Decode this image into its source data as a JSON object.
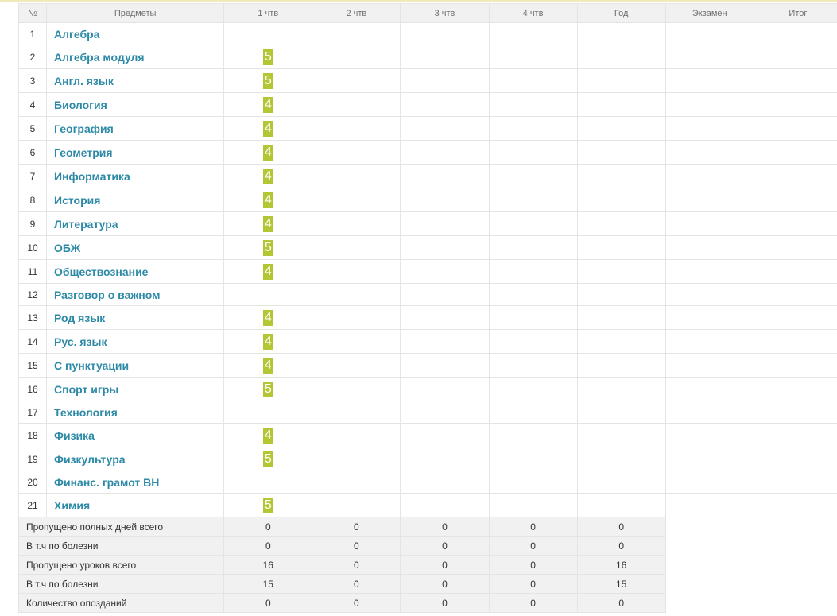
{
  "header": {
    "num": "№",
    "subjects": "Предметы",
    "q1": "1 чтв",
    "q2": "2 чтв",
    "q3": "3 чтв",
    "q4": "4 чтв",
    "year": "Год",
    "exam": "Экзамен",
    "final": "Итог"
  },
  "subjects": [
    {
      "num": "1",
      "name": "Алгебра",
      "q1": ""
    },
    {
      "num": "2",
      "name": "Алгебра модуля",
      "q1": "5"
    },
    {
      "num": "3",
      "name": "Англ. язык",
      "q1": "5"
    },
    {
      "num": "4",
      "name": "Биология",
      "q1": "4"
    },
    {
      "num": "5",
      "name": "География",
      "q1": "4"
    },
    {
      "num": "6",
      "name": "Геометрия",
      "q1": "4"
    },
    {
      "num": "7",
      "name": "Информатика",
      "q1": "4"
    },
    {
      "num": "8",
      "name": "История",
      "q1": "4"
    },
    {
      "num": "9",
      "name": "Литература",
      "q1": "4"
    },
    {
      "num": "10",
      "name": "ОБЖ",
      "q1": "5"
    },
    {
      "num": "11",
      "name": "Обществознание",
      "q1": "4"
    },
    {
      "num": "12",
      "name": "Разговор о важном",
      "q1": ""
    },
    {
      "num": "13",
      "name": "Род язык",
      "q1": "4"
    },
    {
      "num": "14",
      "name": "Рус. язык",
      "q1": "4"
    },
    {
      "num": "15",
      "name": "С пунктуации",
      "q1": "4"
    },
    {
      "num": "16",
      "name": "Спорт игры",
      "q1": "5"
    },
    {
      "num": "17",
      "name": "Технология",
      "q1": ""
    },
    {
      "num": "18",
      "name": "Физика",
      "q1": "4"
    },
    {
      "num": "19",
      "name": "Физкультура",
      "q1": "5"
    },
    {
      "num": "20",
      "name": "Финанс. грамот ВН",
      "q1": ""
    },
    {
      "num": "21",
      "name": "Химия",
      "q1": "5"
    }
  ],
  "summary": [
    {
      "label": "Пропущено полных дней всего",
      "values": [
        "0",
        "0",
        "0",
        "0",
        "0"
      ]
    },
    {
      "label": "В т.ч по болезни",
      "values": [
        "0",
        "0",
        "0",
        "0",
        "0"
      ]
    },
    {
      "label": "Пропущено уроков всего",
      "values": [
        "16",
        "0",
        "0",
        "0",
        "16"
      ]
    },
    {
      "label": "В т.ч по болезни",
      "values": [
        "15",
        "0",
        "0",
        "0",
        "15"
      ]
    },
    {
      "label": "Количество опозданий",
      "values": [
        "0",
        "0",
        "0",
        "0",
        "0"
      ]
    }
  ],
  "colors": {
    "grade_bg": "#b4c634",
    "subject_link": "#2d8aa7",
    "header_bg": "#f1f1f1"
  }
}
